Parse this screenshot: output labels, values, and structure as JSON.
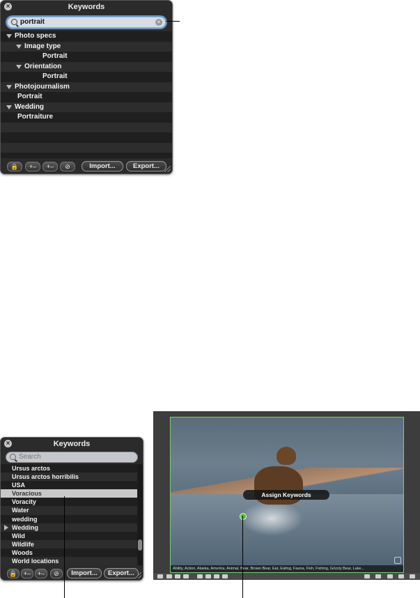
{
  "top_panel": {
    "title": "Keywords",
    "search_value": "portrait",
    "rows": [
      {
        "label": "Photo specs",
        "level": 0,
        "disclosure": "down"
      },
      {
        "label": "Image type",
        "level": 1,
        "disclosure": "down"
      },
      {
        "label": "Portrait",
        "level": 2,
        "disclosure": ""
      },
      {
        "label": "Orientation",
        "level": 1,
        "disclosure": "down"
      },
      {
        "label": "Portrait",
        "level": 2,
        "disclosure": ""
      },
      {
        "label": "Photojournalism",
        "level": 0,
        "disclosure": "down"
      },
      {
        "label": "Portrait",
        "level": 1,
        "disclosure": ""
      },
      {
        "label": "Wedding",
        "level": 0,
        "disclosure": "down"
      },
      {
        "label": "Portraiture",
        "level": 1,
        "disclosure": ""
      },
      {
        "label": "",
        "level": 0,
        "disclosure": ""
      },
      {
        "label": "",
        "level": 0,
        "disclosure": ""
      },
      {
        "label": "",
        "level": 0,
        "disclosure": ""
      },
      {
        "label": "",
        "level": 0,
        "disclosure": ""
      },
      {
        "label": "",
        "level": 0,
        "disclosure": ""
      }
    ],
    "import_label": "Import...",
    "export_label": "Export..."
  },
  "bottom_panel": {
    "title": "Keywords",
    "search_placeholder": "Search",
    "rows": [
      {
        "label": "Ursus arctos",
        "disclosure": "",
        "selected": false
      },
      {
        "label": "Ursus arctos horribilis",
        "disclosure": "",
        "selected": false
      },
      {
        "label": "USA",
        "disclosure": "",
        "selected": false
      },
      {
        "label": "Voracious",
        "disclosure": "",
        "selected": true
      },
      {
        "label": "Voracity",
        "disclosure": "",
        "selected": false
      },
      {
        "label": "Water",
        "disclosure": "",
        "selected": false
      },
      {
        "label": "wedding",
        "disclosure": "",
        "selected": false
      },
      {
        "label": "Wedding",
        "disclosure": "right",
        "selected": false
      },
      {
        "label": "Wild",
        "disclosure": "",
        "selected": false
      },
      {
        "label": "Wildlife",
        "disclosure": "",
        "selected": false
      },
      {
        "label": "Woods",
        "disclosure": "",
        "selected": false
      },
      {
        "label": "World locations",
        "disclosure": "",
        "selected": false
      }
    ],
    "import_label": "Import...",
    "export_label": "Export..."
  },
  "viewer": {
    "assign_label": "Assign Keywords",
    "keywords_text": "Ability, Action, Alaska, America, Animal, Bear, Brown Bear, Eat, Eating, Fauna, Fish, Fishing, Grizzly Bear, Lake..."
  }
}
